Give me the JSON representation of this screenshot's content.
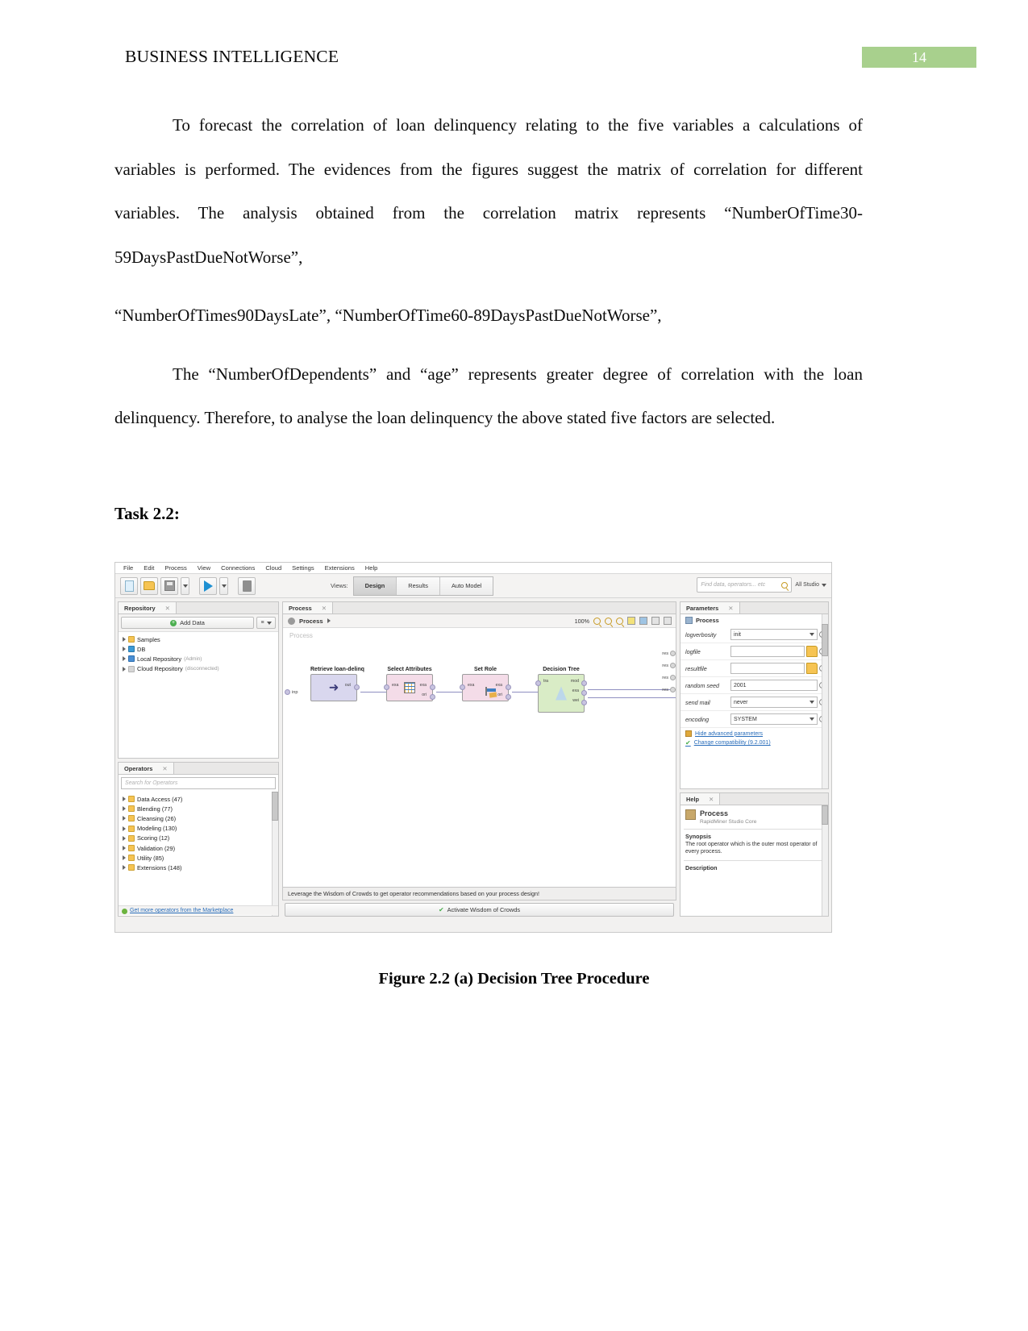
{
  "page": {
    "header_title": "BUSINESS INTELLIGENCE",
    "page_number": "14"
  },
  "body": {
    "paragraph_1": "To forecast the correlation of loan delinquency relating to the five variables a calculations of variables is performed. The evidences from the figures suggest the matrix of correlation for different variables. The analysis obtained from the correlation matrix represents “NumberOfTime30-59DaysPastDueNotWorse”,",
    "paragraph_2": "“NumberOfTimes90DaysLate”, “NumberOfTime60-89DaysPastDueNotWorse”,",
    "paragraph_3": "The “NumberOfDependents” and “age” represents greater degree of correlation with the loan delinquency. Therefore, to analyse the loan delinquency the above stated five factors are selected.",
    "task_heading": "Task 2.2:",
    "figure_caption": "Figure 2.2 (a) Decision Tree Procedure"
  },
  "rapidminer": {
    "menu": [
      "File",
      "Edit",
      "Process",
      "View",
      "Connections",
      "Cloud",
      "Settings",
      "Extensions",
      "Help"
    ],
    "toolbar": {
      "new_process": "new-process",
      "open_process": "open-process",
      "save_process": "save-process",
      "run_process": "run-process",
      "stop_process": "stop-process",
      "views_label": "Views:",
      "view_tabs": [
        "Design",
        "Results",
        "Auto Model"
      ],
      "active_view": "Design",
      "search_placeholder": "Find data, operators... etc",
      "studio_selector": "All Studio"
    },
    "repository": {
      "tab_title": "Repository",
      "add_data_label": "Add Data",
      "items": [
        {
          "label": "Samples",
          "note": "",
          "icon": "folder-icon"
        },
        {
          "label": "DB",
          "note": "",
          "icon": "database-icon"
        },
        {
          "label": "Local Repository",
          "note": "(Admin)",
          "icon": "local-repository-icon"
        },
        {
          "label": "Cloud Repository",
          "note": "(disconnected)",
          "icon": "cloud-repository-icon"
        }
      ]
    },
    "operators": {
      "tab_title": "Operators",
      "search_placeholder": "Search for Operators",
      "groups": [
        {
          "label": "Data Access (47)"
        },
        {
          "label": "Blending (77)"
        },
        {
          "label": "Cleansing (26)"
        },
        {
          "label": "Modeling (130)"
        },
        {
          "label": "Scoring (12)"
        },
        {
          "label": "Validation (29)"
        },
        {
          "label": "Utility (85)"
        },
        {
          "label": "Extensions (148)"
        }
      ],
      "marketplace_link": "Get more operators from the Marketplace"
    },
    "process": {
      "tab_title": "Process",
      "breadcrumb": "Process",
      "zoom_level": "100%",
      "canvas_watermark": "Process",
      "operators": [
        {
          "title": "Retrieve loan-delinq",
          "in_ports": [],
          "out_ports": [
            "out"
          ],
          "color": "violet",
          "glyph": "retrieve-icon"
        },
        {
          "title": "Select Attributes",
          "in_ports": [
            "exa"
          ],
          "out_ports": [
            "exa",
            "ori"
          ],
          "color": "pink",
          "glyph": "select-attributes-icon"
        },
        {
          "title": "Set Role",
          "in_ports": [
            "exa"
          ],
          "out_ports": [
            "exa",
            "ori"
          ],
          "color": "pink",
          "glyph": "set-role-icon"
        },
        {
          "title": "Decision Tree",
          "in_ports": [
            "tra"
          ],
          "out_ports": [
            "mod",
            "exa",
            "wei"
          ],
          "color": "green",
          "glyph": "decision-tree-icon"
        }
      ],
      "process_input_port": "inp",
      "result_ports": [
        "res",
        "res",
        "res",
        "res"
      ],
      "wisdom_hint": "Leverage the Wisdom of Crowds to get operator recommendations based on your process design!",
      "wisdom_button": "Activate Wisdom of Crowds"
    },
    "parameters": {
      "tab_title": "Parameters",
      "header": "Process",
      "rows": [
        {
          "name": "logverbosity",
          "value": "init",
          "control": "combo"
        },
        {
          "name": "logfile",
          "value": "",
          "control": "file"
        },
        {
          "name": "resultfile",
          "value": "",
          "control": "file"
        },
        {
          "name": "random seed",
          "value": "2001",
          "control": "text"
        },
        {
          "name": "send mail",
          "value": "never",
          "control": "combo"
        },
        {
          "name": "encoding",
          "value": "SYSTEM",
          "control": "combo"
        }
      ],
      "hide_advanced": "Hide advanced parameters",
      "change_compatibility": "Change compatibility (9.2.001)"
    },
    "help": {
      "tab_title": "Help",
      "title": "Process",
      "subtitle": "RapidMiner Studio Core",
      "synopsis_heading": "Synopsis",
      "synopsis_text": "The root operator which is the outer most operator of every process.",
      "description_heading": "Description"
    }
  }
}
